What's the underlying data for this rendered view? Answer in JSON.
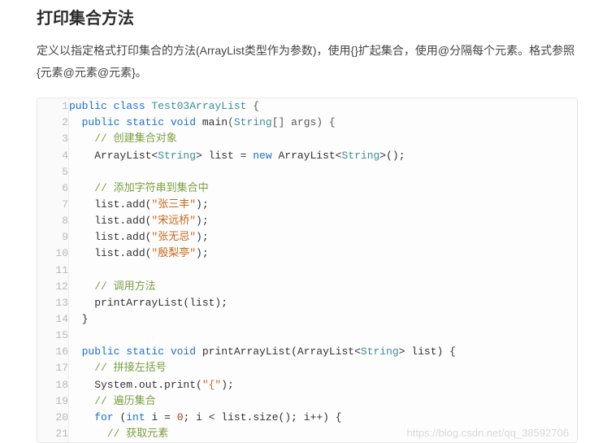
{
  "heading": "打印集合方法",
  "paragraph": "定义以指定格式打印集合的方法(ArrayList类型作为参数)，使用{}扩起集合，使用@分隔每个元素。格式参照 {元素@元素@元素}。",
  "code_lines": [
    [
      {
        "t": "public ",
        "c": "kw"
      },
      {
        "t": "class ",
        "c": "kw"
      },
      {
        "t": "Test03ArrayList",
        "c": "typ"
      },
      {
        "t": " {",
        "c": "op"
      }
    ],
    [
      {
        "t": "  ",
        "c": ""
      },
      {
        "t": "public ",
        "c": "kw"
      },
      {
        "t": "static ",
        "c": "kw"
      },
      {
        "t": "void ",
        "c": "kw"
      },
      {
        "t": "main",
        "c": ""
      },
      {
        "t": "(",
        "c": "op"
      },
      {
        "t": "String",
        "c": "typ"
      },
      {
        "t": "[] args) {",
        "c": "op"
      }
    ],
    [
      {
        "t": "    ",
        "c": ""
      },
      {
        "t": "// 创建集合对象",
        "c": "cmt"
      }
    ],
    [
      {
        "t": "    ArrayList<",
        "c": ""
      },
      {
        "t": "String",
        "c": "typ"
      },
      {
        "t": "> list = ",
        "c": ""
      },
      {
        "t": "new ",
        "c": "kw"
      },
      {
        "t": "ArrayList<",
        "c": ""
      },
      {
        "t": "String",
        "c": "typ"
      },
      {
        "t": ">();",
        "c": ""
      }
    ],
    [
      {
        "t": "",
        "c": ""
      }
    ],
    [
      {
        "t": "    ",
        "c": ""
      },
      {
        "t": "// 添加字符串到集合中",
        "c": "cmt"
      }
    ],
    [
      {
        "t": "    list.add(",
        "c": ""
      },
      {
        "t": "\"张三丰\"",
        "c": "str"
      },
      {
        "t": ");",
        "c": ""
      }
    ],
    [
      {
        "t": "    list.add(",
        "c": ""
      },
      {
        "t": "\"宋远桥\"",
        "c": "str"
      },
      {
        "t": ");",
        "c": ""
      }
    ],
    [
      {
        "t": "    list.add(",
        "c": ""
      },
      {
        "t": "\"张无忌\"",
        "c": "str"
      },
      {
        "t": ");",
        "c": ""
      }
    ],
    [
      {
        "t": "    list.add(",
        "c": ""
      },
      {
        "t": "\"殷梨亭\"",
        "c": "str"
      },
      {
        "t": ");",
        "c": ""
      }
    ],
    [
      {
        "t": "",
        "c": ""
      }
    ],
    [
      {
        "t": "    ",
        "c": ""
      },
      {
        "t": "// 调用方法",
        "c": "cmt"
      }
    ],
    [
      {
        "t": "    printArrayList(list);",
        "c": ""
      }
    ],
    [
      {
        "t": "  }",
        "c": ""
      }
    ],
    [
      {
        "t": "",
        "c": ""
      }
    ],
    [
      {
        "t": "  ",
        "c": ""
      },
      {
        "t": "public ",
        "c": "kw"
      },
      {
        "t": "static ",
        "c": "kw"
      },
      {
        "t": "void ",
        "c": "kw"
      },
      {
        "t": "printArrayList",
        "c": ""
      },
      {
        "t": "(ArrayList<",
        "c": ""
      },
      {
        "t": "String",
        "c": "typ"
      },
      {
        "t": "> list) {",
        "c": ""
      }
    ],
    [
      {
        "t": "    ",
        "c": ""
      },
      {
        "t": "// 拼接左括号",
        "c": "cmt"
      }
    ],
    [
      {
        "t": "    System.out.print(",
        "c": ""
      },
      {
        "t": "\"{\"",
        "c": "str"
      },
      {
        "t": ");",
        "c": ""
      }
    ],
    [
      {
        "t": "    ",
        "c": ""
      },
      {
        "t": "// 遍历集合",
        "c": "cmt"
      }
    ],
    [
      {
        "t": "    ",
        "c": ""
      },
      {
        "t": "for ",
        "c": "kw"
      },
      {
        "t": "(",
        "c": ""
      },
      {
        "t": "int ",
        "c": "kw"
      },
      {
        "t": "i = ",
        "c": ""
      },
      {
        "t": "0",
        "c": "num"
      },
      {
        "t": "; i < list.size(); i++) {",
        "c": ""
      }
    ],
    [
      {
        "t": "      ",
        "c": ""
      },
      {
        "t": "// 获取元素",
        "c": "cmt"
      }
    ]
  ],
  "watermark": "https://blog.csdn.net/qq_38592706"
}
